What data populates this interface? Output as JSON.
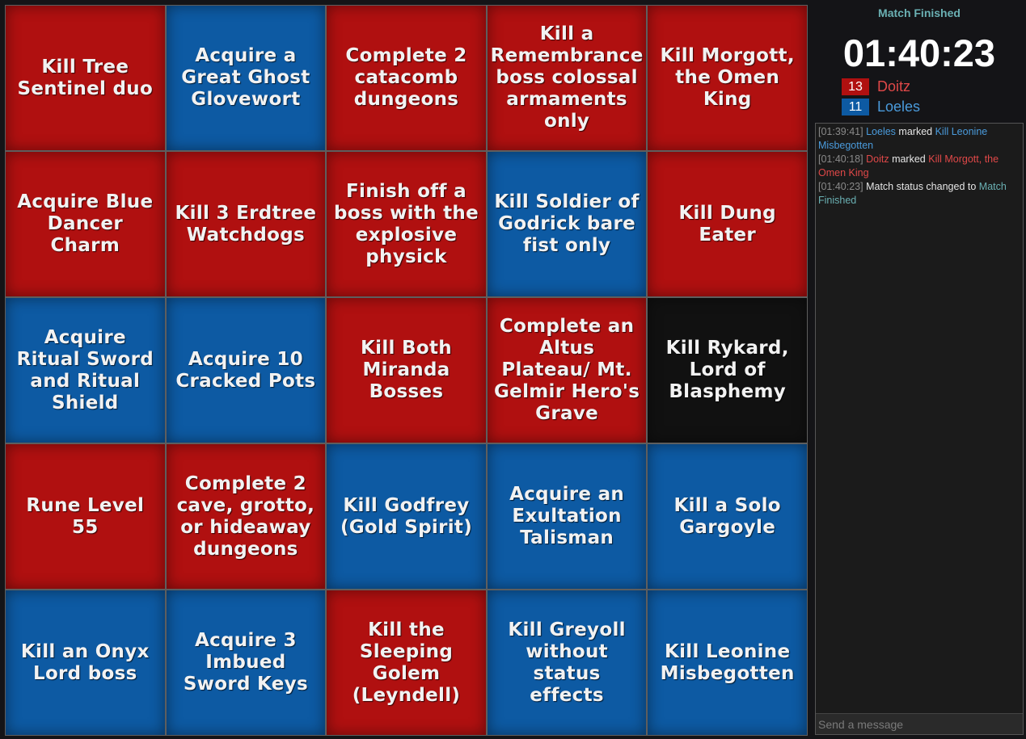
{
  "board": {
    "cells": [
      {
        "text": "Kill Tree Sentinel duo",
        "color": "red"
      },
      {
        "text": "Acquire a Great Ghost Glovewort",
        "color": "blue"
      },
      {
        "text": "Complete 2 catacomb dungeons",
        "color": "red"
      },
      {
        "text": "Kill a Remembrance boss colossal armaments only",
        "color": "red"
      },
      {
        "text": "Kill Morgott, the Omen King",
        "color": "red"
      },
      {
        "text": "Acquire Blue Dancer Charm",
        "color": "red"
      },
      {
        "text": "Kill 3 Erdtree Watchdogs",
        "color": "red"
      },
      {
        "text": "Finish off a boss with the explosive physick",
        "color": "red"
      },
      {
        "text": "Kill Soldier of Godrick bare fist only",
        "color": "blue"
      },
      {
        "text": "Kill Dung Eater",
        "color": "red"
      },
      {
        "text": "Acquire Ritual Sword and Ritual Shield",
        "color": "blue"
      },
      {
        "text": "Acquire 10 Cracked Pots",
        "color": "blue"
      },
      {
        "text": "Kill Both Miranda Bosses",
        "color": "red"
      },
      {
        "text": "Complete an Altus Plateau/ Mt. Gelmir Hero's Grave",
        "color": "red"
      },
      {
        "text": "Kill Rykard, Lord of Blasphemy",
        "color": "black"
      },
      {
        "text": "Rune Level 55",
        "color": "red"
      },
      {
        "text": "Complete 2 cave, grotto, or hideaway dungeons",
        "color": "red"
      },
      {
        "text": "Kill Godfrey (Gold Spirit)",
        "color": "blue"
      },
      {
        "text": "Acquire an Exultation Talisman",
        "color": "blue"
      },
      {
        "text": "Kill a Solo Gargoyle",
        "color": "blue"
      },
      {
        "text": "Kill an Onyx Lord boss",
        "color": "blue"
      },
      {
        "text": "Acquire 3 Imbued Sword Keys",
        "color": "blue"
      },
      {
        "text": "Kill the Sleeping Golem (Leyndell)",
        "color": "red"
      },
      {
        "text": "Kill Greyoll without status effects",
        "color": "blue"
      },
      {
        "text": "Kill Leonine Misbegotten",
        "color": "blue"
      }
    ]
  },
  "colors": {
    "red": "#b01010",
    "blue": "#0d5aa3",
    "black": "#111111",
    "red_text": "#e04848",
    "blue_text": "#4a9bdc",
    "teal_text": "#6ab0b3"
  },
  "sidebar": {
    "status": "Match Finished",
    "timer": "01:40:23",
    "teams": [
      {
        "count": "13",
        "name": "Doitz",
        "color": "red"
      },
      {
        "count": "11",
        "name": "Loeles",
        "color": "blue"
      }
    ]
  },
  "chat": {
    "messages": [
      {
        "time": "[01:39:41]",
        "actor": "Loeles",
        "actor_color": "blue",
        "verb": "marked",
        "target": "Kill Leonine Misbegotten",
        "target_color": "blue"
      },
      {
        "time": "[01:40:18]",
        "actor": "Doitz",
        "actor_color": "red",
        "verb": "marked",
        "target": "Kill Morgott, the Omen King",
        "target_color": "red"
      },
      {
        "time": "[01:40:23]",
        "actor": "",
        "actor_color": "",
        "verb": "Match status changed to",
        "target": "Match Finished",
        "target_color": "teal"
      }
    ],
    "placeholder": "Send a message"
  }
}
